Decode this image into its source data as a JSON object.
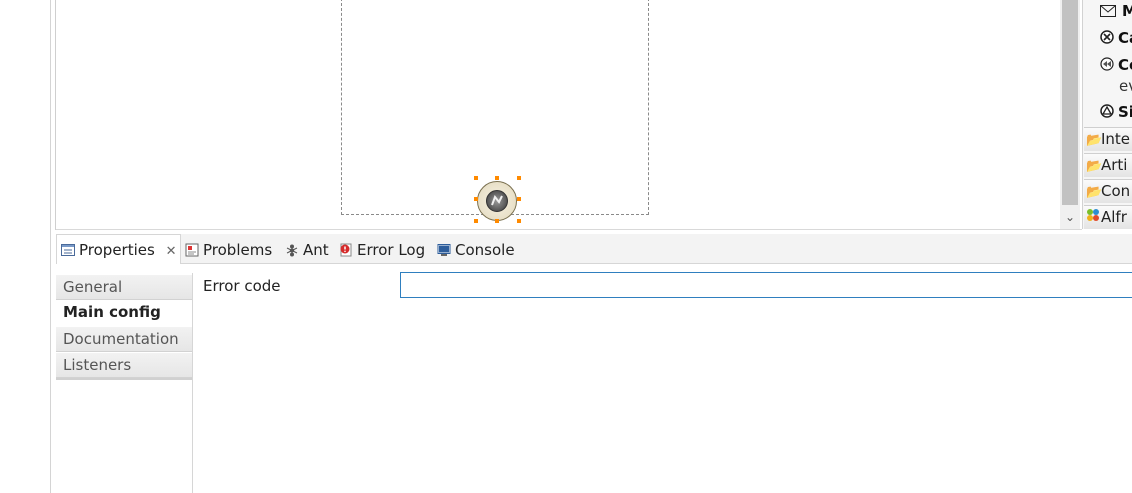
{
  "palette": {
    "items": [
      {
        "label": "M",
        "icon": "envelope-icon"
      },
      {
        "label": "Ca",
        "icon": "cancel-circle-icon"
      },
      {
        "label": "Co",
        "icon": "compensation-circle-icon"
      },
      {
        "label": "ev",
        "icon": ""
      },
      {
        "label": "Si",
        "icon": "signal-circle-icon"
      }
    ],
    "folders": [
      {
        "label": "Inte",
        "icon": "folder-icon"
      },
      {
        "label": "Arti",
        "icon": "folder-icon"
      },
      {
        "label": "Con",
        "icon": "folder-icon"
      },
      {
        "label": "Alfr",
        "icon": "alfresco-icon"
      }
    ]
  },
  "tabs": [
    {
      "label": "Properties",
      "icon": "properties-icon",
      "active": true
    },
    {
      "label": "Problems",
      "icon": "problems-icon"
    },
    {
      "label": "Ant",
      "icon": "ant-icon"
    },
    {
      "label": "Error Log",
      "icon": "error-log-icon"
    },
    {
      "label": "Console",
      "icon": "console-icon"
    }
  ],
  "property_sections": [
    {
      "label": "General"
    },
    {
      "label": "Main config",
      "selected": true
    },
    {
      "label": "Documentation"
    },
    {
      "label": "Listeners"
    }
  ],
  "form": {
    "error_code_label": "Error code",
    "error_code_value": ""
  },
  "colors": {
    "selection_handle": "#ff8a00",
    "input_focus_border": "#2f7fbf"
  }
}
